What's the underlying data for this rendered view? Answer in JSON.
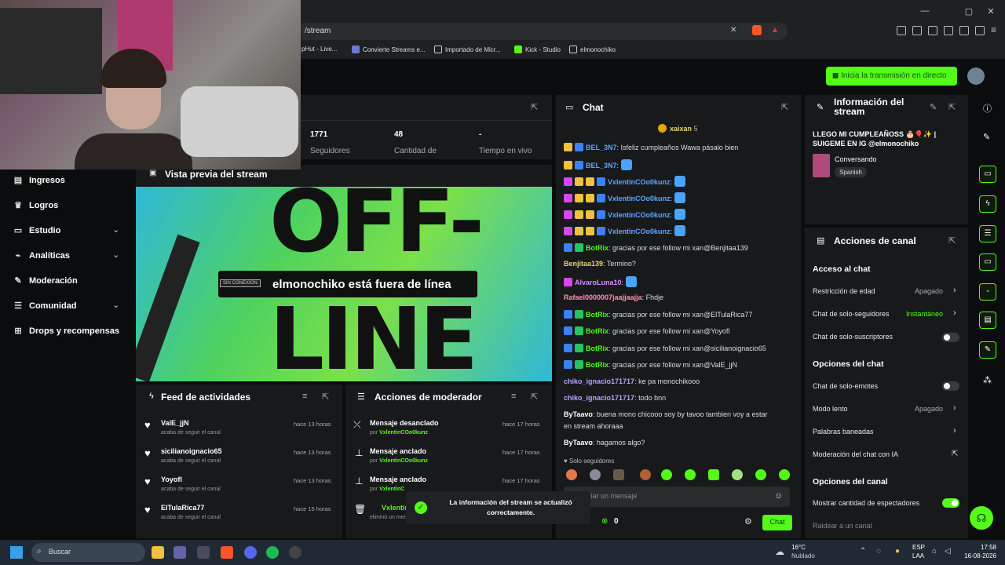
{
  "browser": {
    "url": "/stream",
    "bookmarks": [
      "pHut - Live...",
      "Convierte Streams e...",
      "Importado de Micr...",
      "Kick - Studio",
      "elmonochiko"
    ]
  },
  "header": {
    "go_live": "Inicia la transmisión en directo"
  },
  "sidebar": {
    "items": [
      {
        "label": "Ingresos",
        "icon": "wallet-icon",
        "chevron": false
      },
      {
        "label": "Logros",
        "icon": "trophy-icon",
        "chevron": false
      },
      {
        "label": "Estudio",
        "icon": "studio-icon",
        "chevron": true
      },
      {
        "label": "Analíticas",
        "icon": "analytics-icon",
        "chevron": true
      },
      {
        "label": "Moderación",
        "icon": "wrench-icon",
        "chevron": false
      },
      {
        "label": "Comunidad",
        "icon": "community-icon",
        "chevron": true
      },
      {
        "label": "Drops y recompensas",
        "icon": "gift-icon",
        "chevron": false
      }
    ]
  },
  "stats": [
    {
      "value": "1771",
      "label": "Seguidores"
    },
    {
      "value": "48",
      "label": "Cantidad de"
    },
    {
      "value": "-",
      "label": "Tiempo en vivo"
    }
  ],
  "preview": {
    "title": "Vista previa del stream",
    "big_top": "OFF-",
    "big_bottom": "LINE",
    "tag": "SIN CONEXIÓN",
    "message": "elmonochiko está fuera de línea"
  },
  "activity": {
    "title": "Feed de actividades",
    "rows": [
      {
        "name": "ValE_jjN",
        "sub": "acaba de seguir el canal",
        "time": "hace 13 horas"
      },
      {
        "name": "sicilianoignacio65",
        "sub": "acaba de seguir el canal",
        "time": "hace 13 horas"
      },
      {
        "name": "Yoyofl",
        "sub": "acaba de seguir el canal",
        "time": "hace 13 horas"
      },
      {
        "name": "ElTulaRica77",
        "sub": "acaba de seguir el canal",
        "time": "hace 15 horas"
      }
    ]
  },
  "modactions": {
    "title": "Acciones de moderador",
    "rows": [
      {
        "name": "Mensaje desanclado",
        "sub_prefix": "por ",
        "sub_user": "VxlentinCOo0kunz",
        "time": "hace 17 horas",
        "icon": "unpin-icon"
      },
      {
        "name": "Mensaje anclado",
        "sub_prefix": "por ",
        "sub_user": "VxlentinCOo0kunz",
        "time": "hace 17 horas",
        "icon": "pin-icon"
      },
      {
        "name": "Mensaje anclado",
        "sub_prefix": "por ",
        "sub_user": "VxlentinC",
        "time": "hace 17 horas",
        "icon": "pin-icon"
      },
      {
        "name": "VxlentinCC",
        "sub_prefix": "eliminó un mensaje",
        "sub_user": "",
        "time": "",
        "icon": "trash-icon"
      }
    ]
  },
  "chat": {
    "title": "Chat",
    "pinned_user": "xaixan",
    "pinned_count": "5",
    "messages": [
      {
        "user": "BEL_3N7",
        "text": "Isfeliz cumpleaños Wawa pásalo bien",
        "color": "#5aa7ff"
      },
      {
        "user": "BEL_3N7",
        "text": "",
        "color": "#5aa7ff"
      },
      {
        "user": "VxlentinCOo0kunz",
        "text": "",
        "color": "#5aa7ff"
      },
      {
        "user": "VxlentinCOo0kunz",
        "text": "",
        "color": "#5aa7ff"
      },
      {
        "user": "VxlentinCOo0kunz",
        "text": "",
        "color": "#5aa7ff"
      },
      {
        "user": "VxlentinCOo0kunz",
        "text": "",
        "color": "#5aa7ff"
      },
      {
        "user": "BotRix",
        "text": "gracias por ese follow mi xan@Benjitaa139",
        "color": "#53fc18"
      },
      {
        "user": "Benjitaa139",
        "text": "Termino?",
        "color": "#e8d36a"
      },
      {
        "user": "AlvaroLuna10",
        "text": "",
        "color": "#d98cff"
      },
      {
        "user": "Rafael0000007jaajjaajja",
        "text": "Fhdje",
        "color": "#ff8fb1"
      },
      {
        "user": "BotRix",
        "text": "gracias por ese follow mi xan@ElTulaRica77",
        "color": "#53fc18"
      },
      {
        "user": "BotRix",
        "text": "gracias por ese follow mi xan@Yoyofl",
        "color": "#53fc18"
      },
      {
        "user": "BotRix",
        "text": "gracias por ese follow mi xan@sicilianoignacio65",
        "color": "#53fc18"
      },
      {
        "user": "BotRix",
        "text": "gracias por ese follow mi xan@ValE_jjN",
        "color": "#53fc18"
      },
      {
        "user": "chiko_ignacio171717",
        "text": "ke pa monochikooo",
        "color": "#b8a3ff"
      },
      {
        "user": "chiko_ignacio171717",
        "text": "todo bnn",
        "color": "#b8a3ff"
      },
      {
        "user": "ByTaavo",
        "text": "buena mono chicooo soy by tavoo tambien voy a estar",
        "color": "#ffffff"
      },
      {
        "user": "",
        "text": "en stream ahoraaa",
        "color": "#ffffff"
      },
      {
        "user": "ByTaavo",
        "text": "hagamos algo?",
        "color": "#ffffff"
      }
    ],
    "followers_only": "Solo seguidores",
    "input_placeholder": "viar un mensaje",
    "points": "0",
    "send": "Chat"
  },
  "info": {
    "title": "Información del stream",
    "stream_title": "LLEGO MI CUMPLEAÑOSS 🎂🎈✨ | SUIGEME EN IG @elmonochiko",
    "category": "Conversando",
    "language": "Spanish"
  },
  "channel": {
    "title": "Acciones de canal",
    "chat_access": "Acceso al chat",
    "age": {
      "label": "Restricción de edad",
      "value": "Apagado"
    },
    "followers": {
      "label": "Chat de solo-seguidores",
      "value": "Instantáneo"
    },
    "subs": {
      "label": "Chat de solo-suscriptores"
    },
    "chat_options": "Opciones del chat",
    "emotes": {
      "label": "Chat de solo-emotes"
    },
    "slow": {
      "label": "Modo lento",
      "value": "Apagado"
    },
    "banned": {
      "label": "Palabras baneadas"
    },
    "ai": {
      "label": "Moderación del chat con IA"
    },
    "channel_options": "Opciones del canal",
    "viewers": {
      "label": "Mostrar cantidad de espectadores"
    },
    "raid": {
      "label": "Raidear a un canal"
    }
  },
  "toast": {
    "line1": "La información del stream se actualizó",
    "line2": "correctamente."
  },
  "taskbar": {
    "search": "Buscar",
    "weather_temp": "16°C",
    "weather_desc": "Nublado",
    "lang1": "ESP",
    "lang2": "LAA",
    "time": "17:58",
    "date": "16-08-2026"
  }
}
